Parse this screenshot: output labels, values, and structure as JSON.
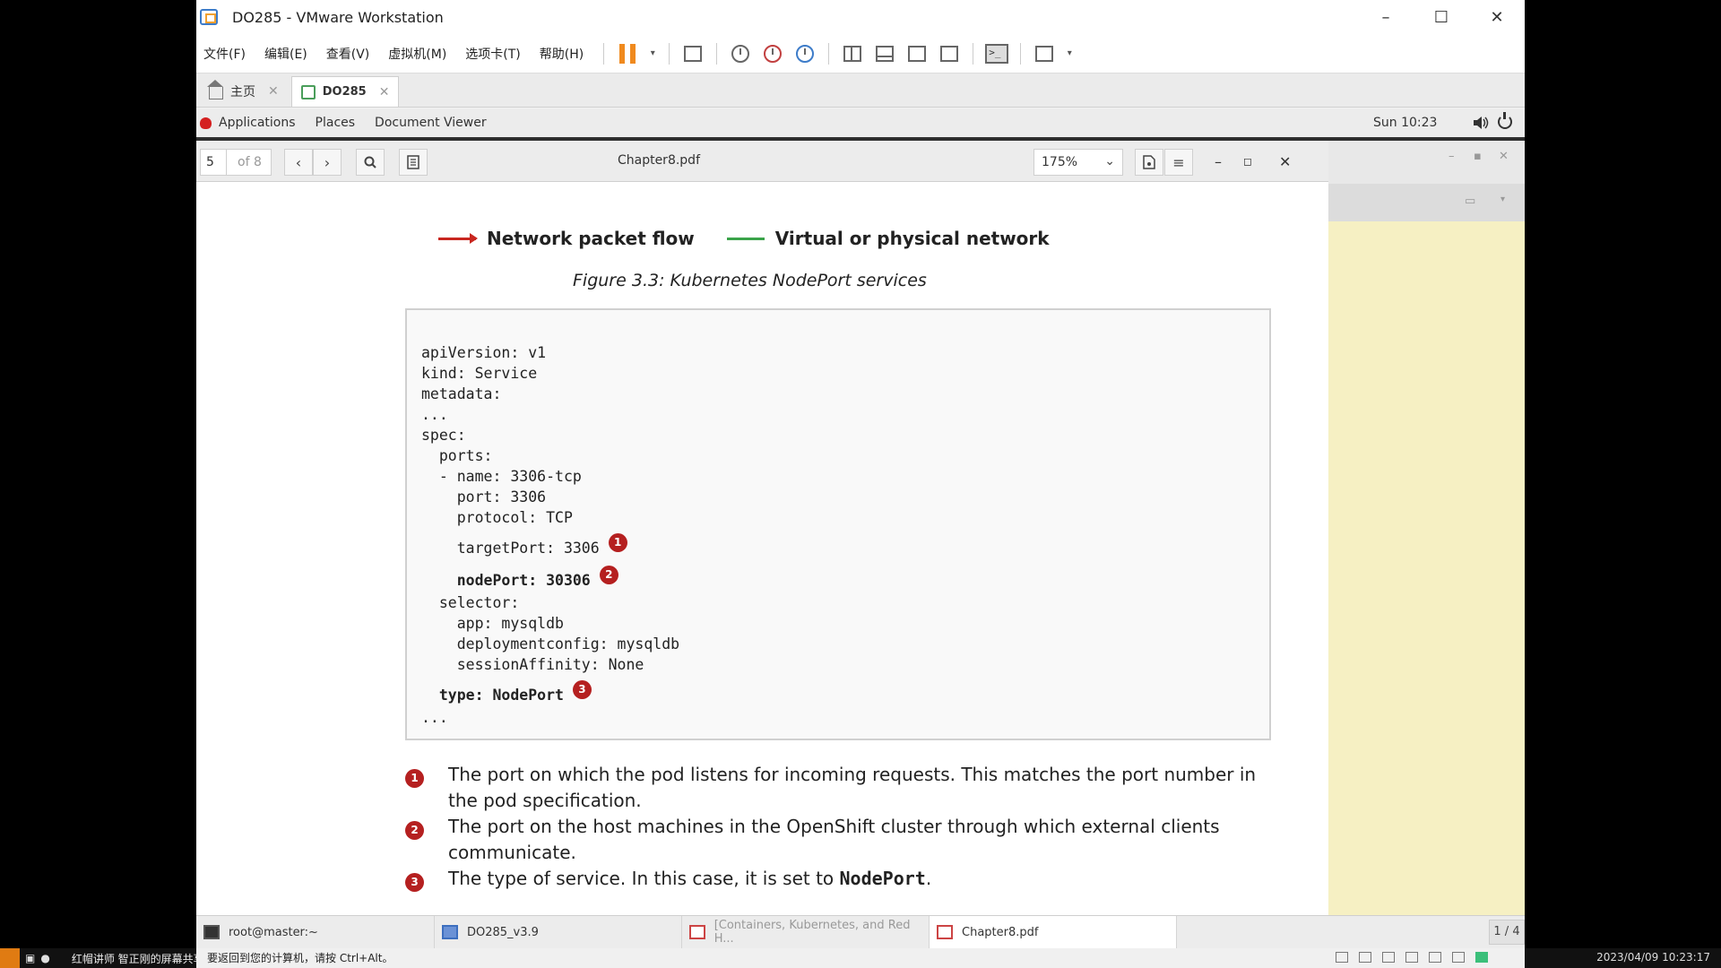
{
  "vmware": {
    "title": "DO285 - VMware Workstation",
    "menu": [
      "文件(F)",
      "编辑(E)",
      "查看(V)",
      "虚拟机(M)",
      "选项卡(T)",
      "帮助(H)"
    ],
    "tabs": [
      {
        "label": "主页",
        "active": false
      },
      {
        "label": "DO285",
        "active": true
      }
    ]
  },
  "gnome": {
    "menu": [
      "Applications",
      "Places",
      "Document Viewer"
    ],
    "clock": "Sun 10:23"
  },
  "viewer": {
    "page_current": "5",
    "page_total": "of 8",
    "title": "Chapter8.pdf",
    "zoom": "175%"
  },
  "document": {
    "legend": {
      "flow": "Network packet flow",
      "network": "Virtual or physical network"
    },
    "figure_caption": "Figure 3.3: Kubernetes NodePort services",
    "code": {
      "l1": "apiVersion: v1",
      "l2": "kind: Service",
      "l3": "metadata:",
      "l4": "...",
      "l5": "spec:",
      "l6": "  ports:",
      "l7": "  - name: 3306-tcp",
      "l8": "    port: 3306",
      "l9": "    protocol: TCP",
      "l10": "    targetPort: 3306",
      "l11": "    nodePort: 30306",
      "l12": "  selector:",
      "l13": "    app: mysqldb",
      "l14": "    deploymentconfig: mysqldb",
      "l15": "    sessionAffinity: None",
      "l16": "  type: NodePort",
      "l17": "..."
    },
    "callouts": [
      "1",
      "2",
      "3"
    ],
    "notes": [
      "The port on which the pod listens for incoming requests. This matches the port number in the pod specification.",
      "The port on the host machines in the OpenShift cluster through which external clients communicate.",
      "The type of service. In this case, it is set to "
    ],
    "note3_code": "NodePort",
    "note3_tail": "."
  },
  "guest_taskbar": {
    "items": [
      "root@master:~",
      "DO285_v3.9",
      "[Containers, Kubernetes, and Red H...",
      "Chapter8.pdf"
    ],
    "workspace": "1 / 4"
  },
  "host": {
    "label": "红帽讲师 智正刚的屏幕共享",
    "status": "要返回到您的计算机，请按 Ctrl+Alt。",
    "clock": "2023/04/09 10:23:17"
  }
}
